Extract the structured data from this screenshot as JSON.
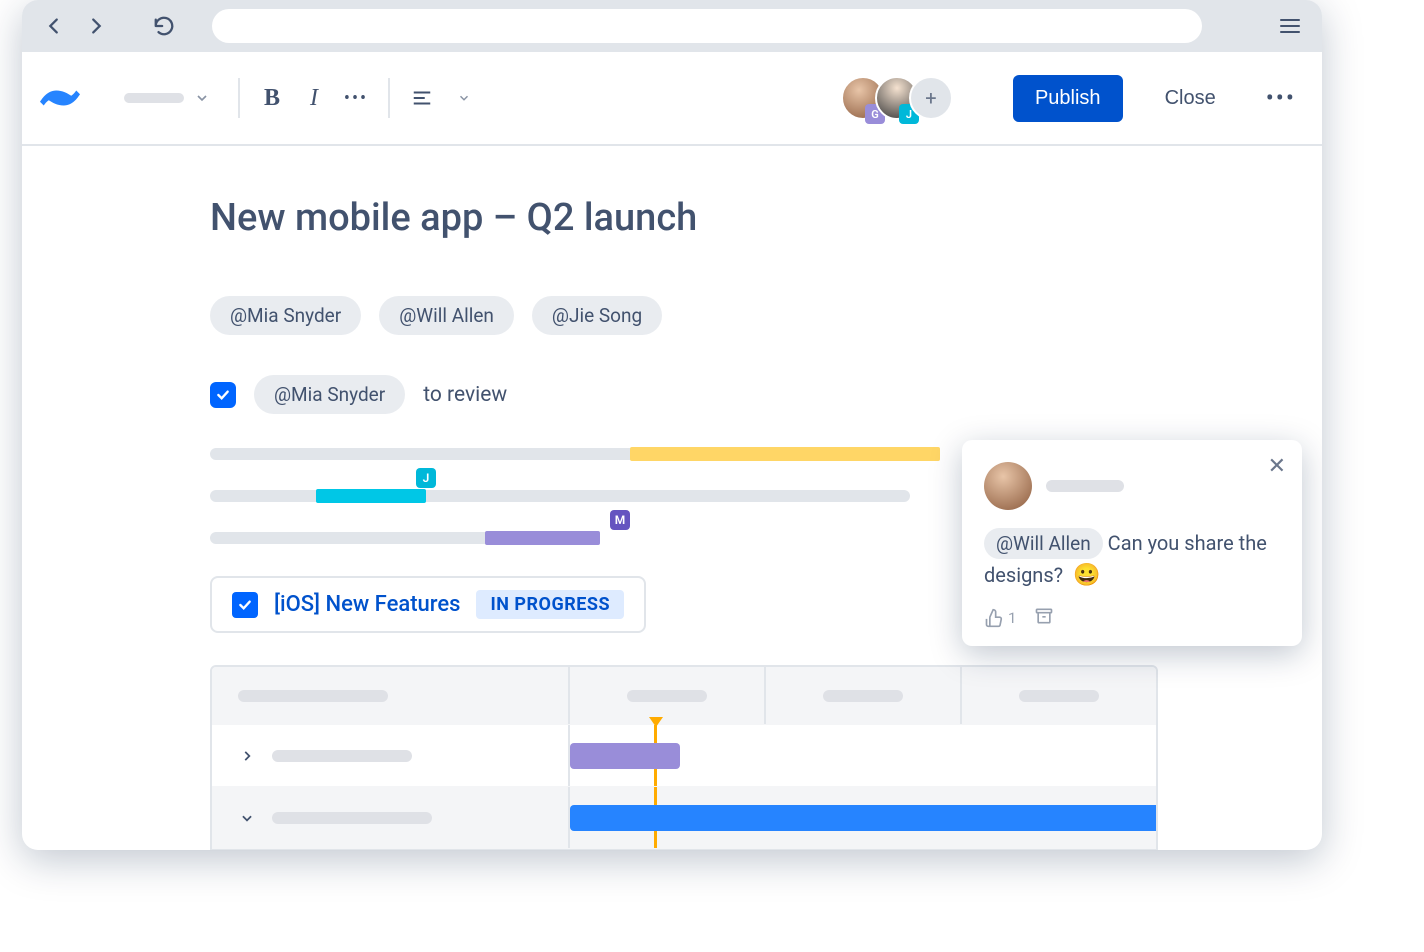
{
  "header": {
    "publish_label": "Publish",
    "close_label": "Close",
    "avatar_badges": [
      "G",
      "J"
    ]
  },
  "page": {
    "title": "New mobile app – Q2 launch",
    "mentions": [
      "@Mia Snyder",
      "@Will Allen",
      "@Jie Song"
    ],
    "task": {
      "checked": true,
      "assignee": "@Mia Snyder",
      "text": "to review"
    },
    "highlight_markers": {
      "j": "J",
      "m": "M"
    },
    "feature": {
      "title": "[iOS] New Features",
      "status": "IN PROGRESS"
    }
  },
  "comment": {
    "mention": "@Will Allen",
    "text_after": "Can you share the designs?",
    "emoji": "😀",
    "like_count": "1"
  },
  "colors": {
    "primary": "#0052cc",
    "yellow": "#ffd666",
    "cyan": "#00c7e6",
    "purple": "#998dd9",
    "blue_bar": "#2684ff"
  }
}
